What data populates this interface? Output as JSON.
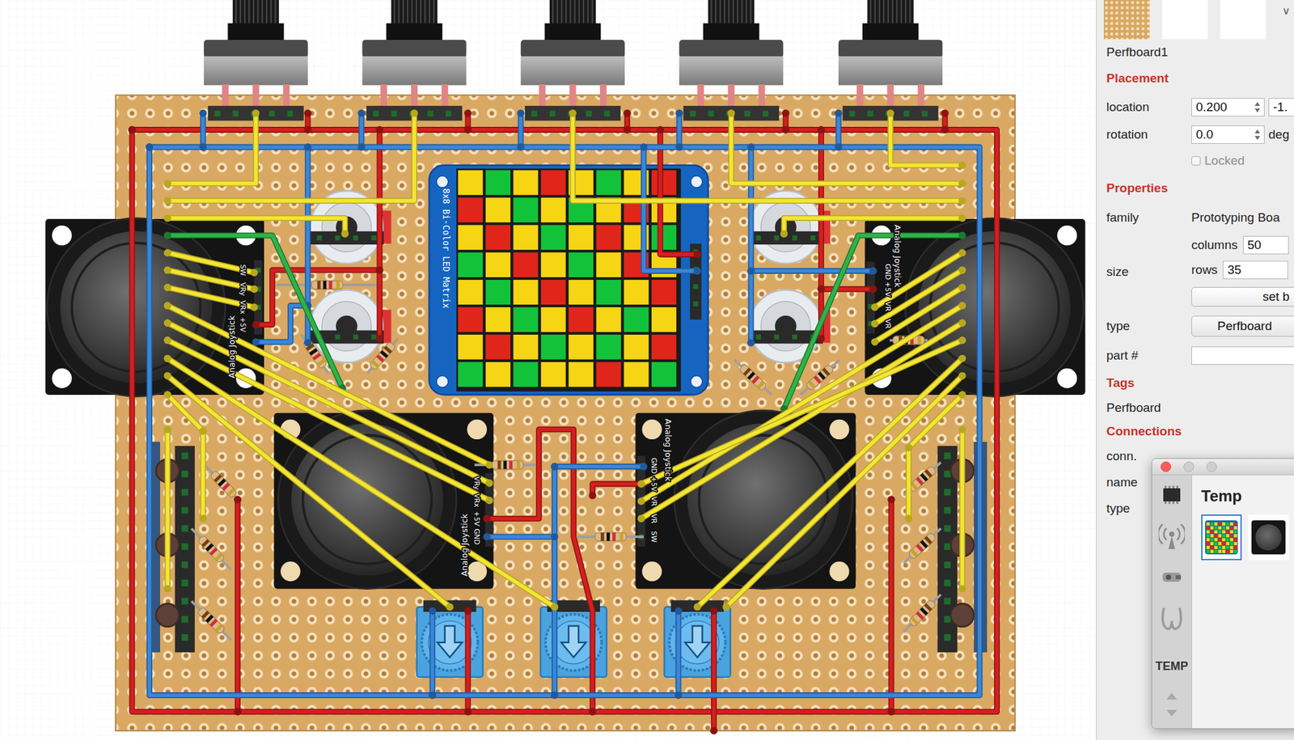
{
  "canvas": {
    "led_matrix": {
      "label": "8x8 Bi-Color LED Matrix",
      "rows": [
        "YGYRYGYR",
        "RYGYGYRY",
        "YRYGYRYG",
        "GYRYGYRY",
        "YGYRYGYR",
        "RYGYRYGY",
        "YRYGYGYR",
        "GYGYYRYG"
      ]
    },
    "joysticks": [
      {
        "label": "Analog Joystick",
        "pins": [
          "SW",
          "VRy",
          "VRx",
          "+5V"
        ]
      },
      {
        "label": "Analog Joystick",
        "pins": [
          "GND",
          "+5V",
          "VR",
          "VR"
        ]
      },
      {
        "label": "Analog Joystick",
        "pins": [
          "VRy",
          "VRx",
          "+5V",
          "GND"
        ]
      },
      {
        "label": "Analog Joystick",
        "pins": [
          "GND",
          "+5V",
          "VR",
          "VR",
          "SW"
        ]
      }
    ]
  },
  "inspector": {
    "corner": "v",
    "title": "Perfboard1",
    "placement": {
      "heading": "Placement",
      "location_label": "location",
      "x": "0.200",
      "y": "-1.",
      "rotation_label": "rotation",
      "rotation": "0.0",
      "rotation_unit": "deg",
      "locked_label": "Locked",
      "locked": false
    },
    "properties": {
      "heading": "Properties",
      "family_label": "family",
      "family": "Prototyping Boa",
      "size_label": "size",
      "columns_label": "columns",
      "columns": "50",
      "rows_label": "rows",
      "rows": "35",
      "size_button": "set b",
      "type_label": "type",
      "type": "Perfboard",
      "part_label": "part #",
      "part": ""
    },
    "tags": {
      "heading": "Tags",
      "value": "Perfboard"
    },
    "connections": {
      "heading": "Connections",
      "labels": [
        "conn.",
        "name",
        "type"
      ]
    }
  },
  "temp_window": {
    "title": "Temp",
    "bin_label": "TEMP",
    "items": [
      {
        "kind": "led-matrix",
        "selected": true
      },
      {
        "kind": "joystick",
        "selected": false
      }
    ]
  }
}
